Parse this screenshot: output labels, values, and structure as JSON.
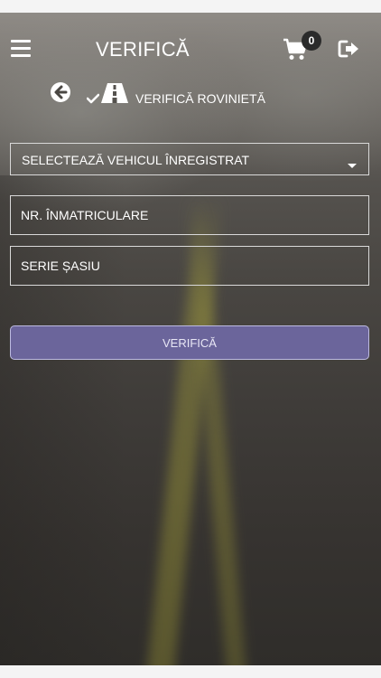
{
  "header": {
    "title": "VERIFICĂ",
    "cart_count": "0",
    "icons": {
      "menu": "hamburger-menu-icon",
      "cart": "shopping-cart-icon",
      "logout": "logout-icon"
    }
  },
  "sub_header": {
    "title": "VERIFICĂ ROVINIETĂ",
    "icons": {
      "back": "back-arrow-icon",
      "check": "checkmark-icon",
      "road": "road-icon"
    }
  },
  "form": {
    "vehicle_select": {
      "value": "SELECTEAZĂ VEHICUL ÎNREGISTRAT"
    },
    "plate_number": {
      "placeholder": "NR. ÎNMATRICULARE",
      "value": ""
    },
    "chassis_series": {
      "placeholder": "SERIE ȘASIU",
      "value": ""
    },
    "submit_label": "VERIFICĂ"
  },
  "colors": {
    "button_bg": "#6b659b",
    "button_border": "#bdbbe0",
    "field_border": "#d9d9d9",
    "badge_bg": "#2b2b2b"
  }
}
